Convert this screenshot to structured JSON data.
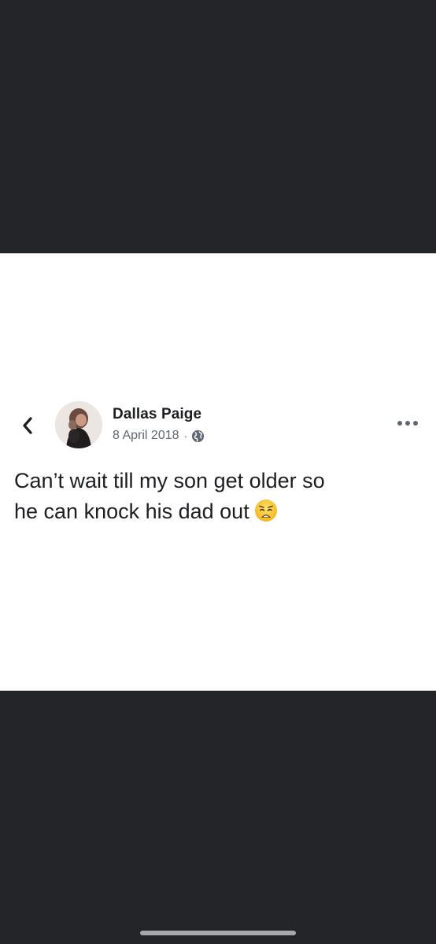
{
  "post": {
    "author": {
      "name": "Dallas Paige",
      "avatar_icon": "profile-photo-avatar"
    },
    "date": "8 April 2018",
    "separator": "·",
    "audience_icon": "globe-icon",
    "text_line_1": "Can’t wait till my son get older so",
    "text_line_2": "he can knock his dad out",
    "emoji": "weary-face-emoji"
  },
  "nav": {
    "back_icon": "chevron-left-icon",
    "more_icon": "more-horizontal-icon"
  },
  "colors": {
    "background_dark": "#242528",
    "card": "#ffffff",
    "text_primary": "#1c1e21",
    "text_secondary": "#606770",
    "emoji_face": "#f7c32e"
  }
}
